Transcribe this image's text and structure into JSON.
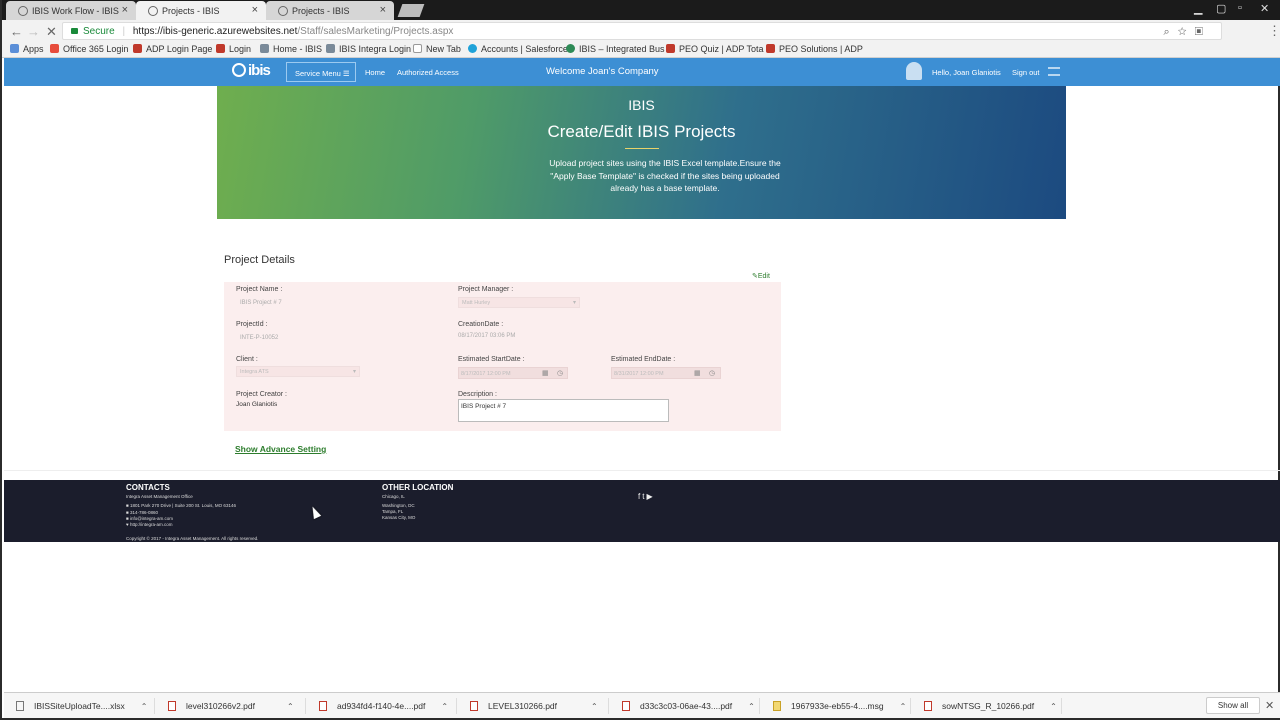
{
  "browser": {
    "tabs": [
      {
        "label": "IBIS Work Flow - IBIS"
      },
      {
        "label": "Projects - IBIS"
      },
      {
        "label": "Projects - IBIS"
      }
    ],
    "secure_label": "Secure",
    "url_host": "https://ibis-generic.azurewebsites.net",
    "url_path": "/Staff/salesMarketing/Projects.aspx",
    "bookmarks": [
      {
        "label": "Apps",
        "color": "#5b8fd8"
      },
      {
        "label": "Office 365 Login",
        "color": "#e74c3c"
      },
      {
        "label": "ADP Login Page",
        "color": "#c0392b"
      },
      {
        "label": "Login",
        "color": "#c0392b"
      },
      {
        "label": "Home - IBIS",
        "color": "#7a8a99"
      },
      {
        "label": "IBIS Integra Login",
        "color": "#7a8a99"
      },
      {
        "label": "New Tab",
        "color": "#999999"
      },
      {
        "label": "Accounts | Salesforce",
        "color": "#1fa2d8"
      },
      {
        "label": "IBIS – Integrated Bus",
        "color": "#2e8b57"
      },
      {
        "label": "PEO Quiz | ADP Tota",
        "color": "#c0392b"
      },
      {
        "label": "PEO Solutions | ADP",
        "color": "#c0392b"
      }
    ]
  },
  "site_nav": {
    "logo": "ibis",
    "service_menu": "Service Menu ☰",
    "home": "Home",
    "authorized_access": "Authorized Access",
    "welcome": "Welcome Joan's Company",
    "hello": "Hello, Joan Glaniotis",
    "sign_out": "Sign out"
  },
  "hero": {
    "brand": "IBIS",
    "title": "Create/Edit IBIS Projects",
    "description": "Upload project sites using the IBIS Excel template.Ensure the \"Apply Base Template\" is checked if the sites being uploaded already has a base template."
  },
  "project_details": {
    "section_title": "Project Details",
    "edit_label": "Edit",
    "project_name_label": "Project Name :",
    "project_name_value": "IBIS Project # 7",
    "project_manager_label": "Project Manager :",
    "project_manager_value": "Matt Hurley",
    "project_id_label": "ProjectId :",
    "project_id_value": "INTE-P-10052",
    "creation_date_label": "CreationDate :",
    "creation_date_value": "08/17/2017 03:06 PM",
    "client_label": "Client :",
    "client_value": "Integra ATS",
    "est_start_label": "Estimated StartDate :",
    "est_start_value": "8/17/2017 12:00 PM",
    "est_end_label": "Estimated EndDate :",
    "est_end_value": "8/31/2017 12:00 PM",
    "creator_label": "Project Creator :",
    "creator_value": "Joan Glaniotis",
    "description_label": "Description :",
    "description_value": "IBIS Project # 7",
    "advance_setting": "Show Advance Setting"
  },
  "footer": {
    "contacts_title": "CONTACTS",
    "company": "Integra Asset Management Office",
    "address": "1801 Park 270 Drive | Suite 200 St. Louis, MO 63146",
    "phone": "314-786-0860",
    "email": "info@integra-am.com",
    "web": "http://integra-am.com",
    "copyright": "Copyright © 2017 - Integra Asset Management. All rights reserved.",
    "other_title": "OTHER LOCATION",
    "loc1": "Chicago, IL",
    "loc2": "Washington, DC",
    "loc3": "Tampa, FL",
    "loc4": "Kansas City, MO",
    "social": "f t ▶"
  },
  "downloads": {
    "items": [
      {
        "name": "IBISSiteUploadTe....xlsx",
        "type": "xls"
      },
      {
        "name": "level310266v2.pdf",
        "type": "pdf"
      },
      {
        "name": "ad934fd4-f140-4e....pdf",
        "type": "pdf"
      },
      {
        "name": "LEVEL310266.pdf",
        "type": "pdf"
      },
      {
        "name": "d33c3c03-06ae-43....pdf",
        "type": "pdf"
      },
      {
        "name": "1967933e-eb55-4....msg",
        "type": "msg"
      },
      {
        "name": "sowNTSG_R_10266.pdf",
        "type": "pdf"
      }
    ],
    "show_all": "Show all"
  }
}
